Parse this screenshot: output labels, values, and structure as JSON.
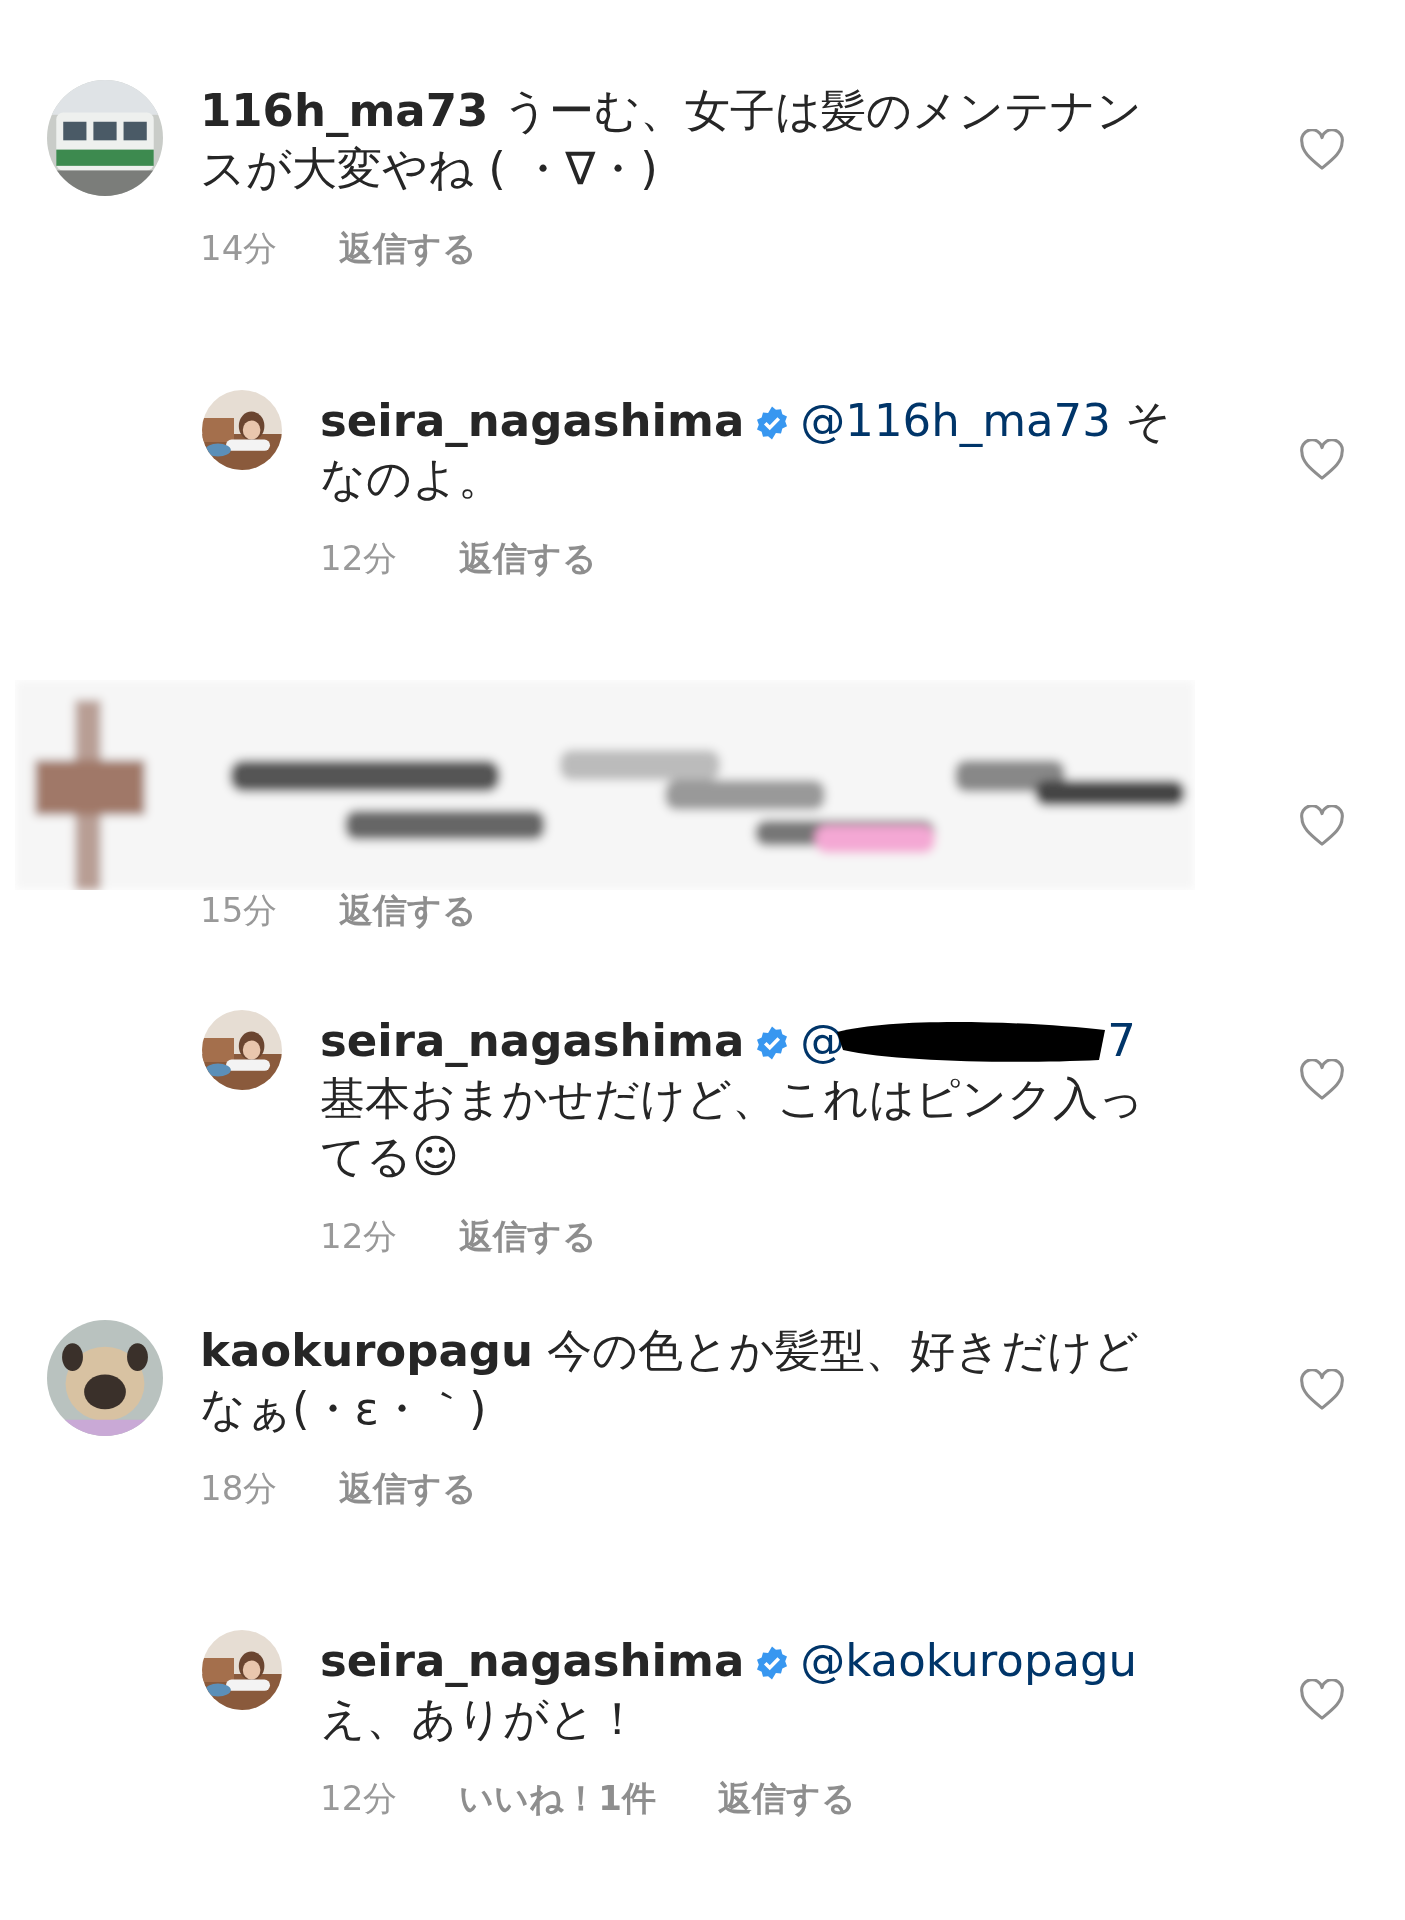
{
  "comments": [
    {
      "kind": "comment",
      "username": "116h_ma73",
      "verified": false,
      "text": "うーむ、女子は髪のメンテナンスが大変やね ( ・∇・)",
      "time": "14分",
      "reply_label": "返信する"
    },
    {
      "kind": "reply",
      "username": "seira_nagashima",
      "verified": true,
      "mention": [
        "@116h_ma73"
      ],
      "text": "そなのよ。",
      "time": "12分",
      "reply_label": "返信する"
    },
    {
      "kind": "hidden",
      "time": "15分",
      "reply_label": "返信する"
    },
    {
      "kind": "reply",
      "username": "seira_nagashima",
      "verified": true,
      "mention": [
        "@",
        "7"
      ],
      "text": "基本おまかせだけど、これはピンク入ってる☺",
      "time": "12分",
      "reply_label": "返信する"
    },
    {
      "kind": "comment",
      "username": "kaokuropagu",
      "verified": false,
      "text": "今の色とか髪型、好きだけどなぁ(・ε・｀)",
      "time": "18分",
      "reply_label": "返信する"
    },
    {
      "kind": "reply",
      "username": "seira_nagashima",
      "verified": true,
      "mention": [
        "@kaokuropagu"
      ],
      "text": "え、ありがと！",
      "time": "12分",
      "likes": "いいね！1件",
      "reply_label": "返信する"
    }
  ]
}
